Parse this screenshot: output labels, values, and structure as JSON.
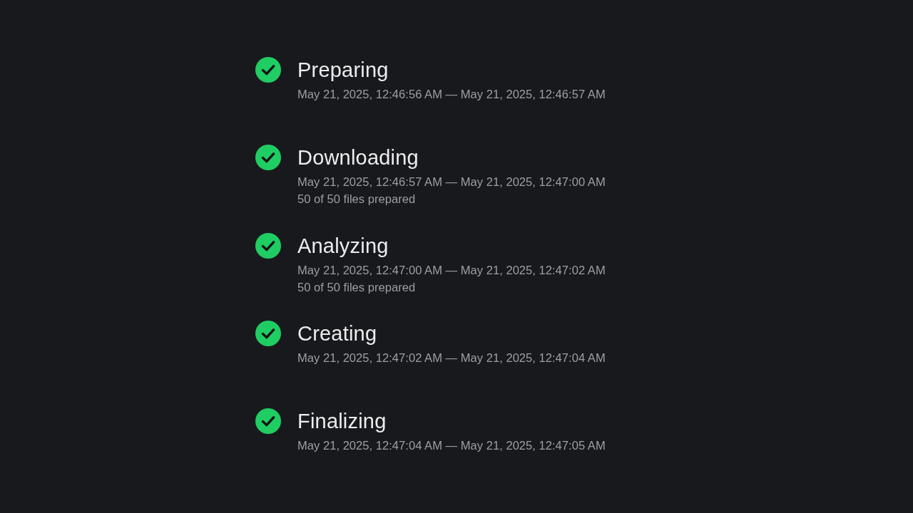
{
  "steps": [
    {
      "title": "Preparing",
      "completed": true,
      "time_range": "May 21, 2025, 12:46:56 AM — May 21, 2025, 12:46:57 AM"
    },
    {
      "title": "Downloading",
      "completed": true,
      "time_range": "May 21, 2025, 12:46:57 AM — May 21, 2025, 12:47:00 AM",
      "detail": "50 of 50 files prepared"
    },
    {
      "title": "Analyzing",
      "completed": true,
      "time_range": "May 21, 2025, 12:47:00 AM — May 21, 2025, 12:47:02 AM",
      "detail": "50 of 50 files prepared"
    },
    {
      "title": "Creating",
      "completed": true,
      "time_range": "May 21, 2025, 12:47:02 AM — May 21, 2025, 12:47:04 AM"
    },
    {
      "title": "Finalizing",
      "completed": true,
      "time_range": "May 21, 2025, 12:47:04 AM — May 21, 2025, 12:47:05 AM"
    }
  ]
}
